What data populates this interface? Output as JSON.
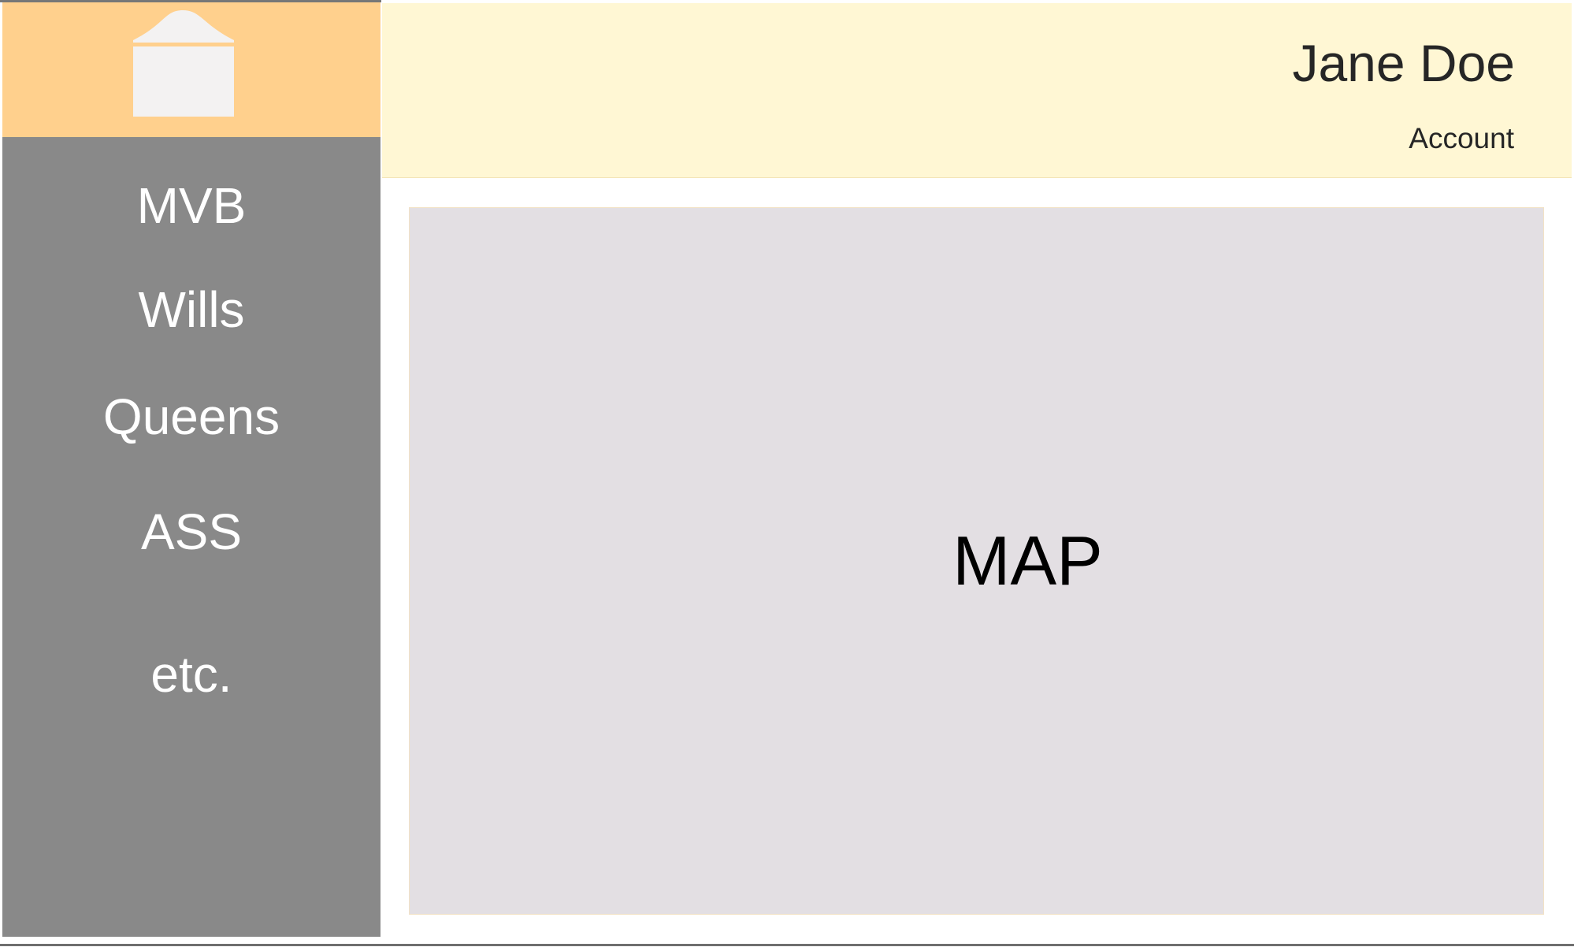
{
  "sidebar": {
    "logo_icon": "home-icon",
    "items": [
      {
        "label": "MVB"
      },
      {
        "label": "Wills"
      },
      {
        "label": "Queens"
      },
      {
        "label": "ASS"
      },
      {
        "label": "etc."
      }
    ]
  },
  "header": {
    "user_name": "Jane Doe",
    "account_label": "Account"
  },
  "main": {
    "map_label": "MAP"
  },
  "colors": {
    "sidebar_bg": "#898989",
    "logo_bg": "#ffd08d",
    "header_bg": "#fff7d4",
    "map_bg": "#e3dfe3",
    "nav_text": "#ffffff"
  }
}
